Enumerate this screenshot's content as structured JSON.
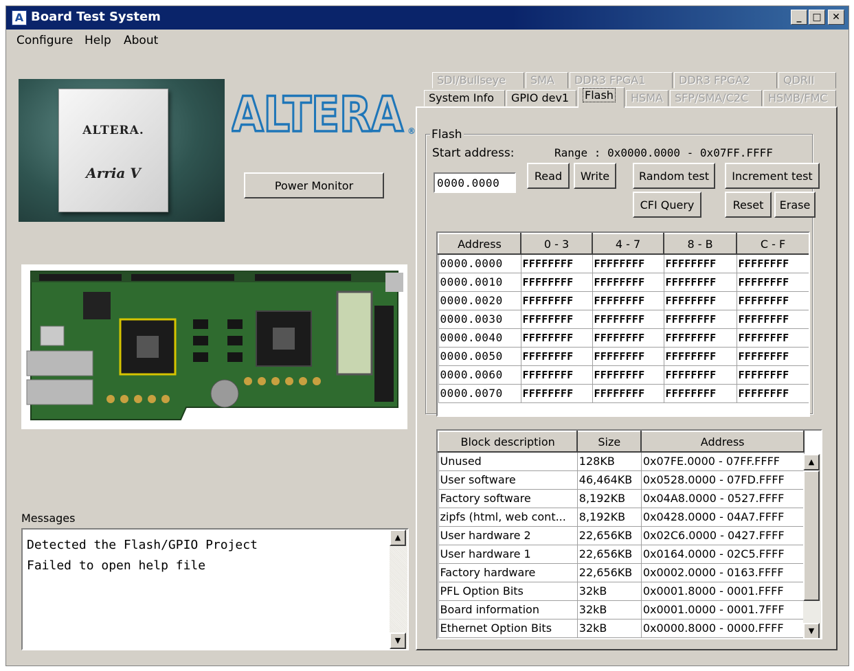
{
  "window": {
    "title": "Board Test System",
    "app_icon": "A"
  },
  "titlebar_buttons": {
    "minimize": "_",
    "maximize": "□",
    "close": "✕"
  },
  "menu": [
    "Configure",
    "Help",
    "About"
  ],
  "chip": {
    "brand": "ALTERA.",
    "family": "Arria V"
  },
  "logo": {
    "text": "ALTERA",
    "mark": "®"
  },
  "power_monitor_label": "Power Monitor",
  "messages": {
    "label": "Messages",
    "lines": "Detected the Flash/GPIO Project\nFailed to open help file"
  },
  "tabs": {
    "row_back": [
      "SDI/Bullseye",
      "SMA",
      "DDR3 FPGA1",
      "DDR3 FPGA2",
      "QDRII"
    ],
    "row_front": [
      "System Info",
      "GPIO dev1",
      "Flash",
      "HSMA",
      "SFP/SMA/C2C",
      "HSMB/FMC"
    ],
    "active": "Flash"
  },
  "flash": {
    "group_title": "Flash",
    "start_address_label": "Start address:",
    "start_address_value": "0000.0000",
    "range_label": "Range : 0x0000.0000 - 0x07FF.FFFF",
    "buttons": {
      "read": "Read",
      "write": "Write",
      "random_test": "Random test",
      "increment_test": "Increment test",
      "cfi_query": "CFI Query",
      "reset": "Reset",
      "erase": "Erase"
    }
  },
  "memory_table": {
    "headers": [
      "Address",
      "0 - 3",
      "4 - 7",
      "8 - B",
      "C - F"
    ],
    "rows": [
      [
        "0000.0000",
        "FFFFFFFF",
        "FFFFFFFF",
        "FFFFFFFF",
        "FFFFFFFF"
      ],
      [
        "0000.0010",
        "FFFFFFFF",
        "FFFFFFFF",
        "FFFFFFFF",
        "FFFFFFFF"
      ],
      [
        "0000.0020",
        "FFFFFFFF",
        "FFFFFFFF",
        "FFFFFFFF",
        "FFFFFFFF"
      ],
      [
        "0000.0030",
        "FFFFFFFF",
        "FFFFFFFF",
        "FFFFFFFF",
        "FFFFFFFF"
      ],
      [
        "0000.0040",
        "FFFFFFFF",
        "FFFFFFFF",
        "FFFFFFFF",
        "FFFFFFFF"
      ],
      [
        "0000.0050",
        "FFFFFFFF",
        "FFFFFFFF",
        "FFFFFFFF",
        "FFFFFFFF"
      ],
      [
        "0000.0060",
        "FFFFFFFF",
        "FFFFFFFF",
        "FFFFFFFF",
        "FFFFFFFF"
      ],
      [
        "0000.0070",
        "FFFFFFFF",
        "FFFFFFFF",
        "FFFFFFFF",
        "FFFFFFFF"
      ]
    ]
  },
  "block_table": {
    "headers": [
      "Block description",
      "Size",
      "Address"
    ],
    "rows": [
      [
        "Unused",
        "128KB",
        "0x07FE.0000 - 07FF.FFFF"
      ],
      [
        "User software",
        "46,464KB",
        "0x0528.0000 - 07FD.FFFF"
      ],
      [
        "Factory software",
        "8,192KB",
        "0x04A8.0000 - 0527.FFFF"
      ],
      [
        "zipfs (html, web cont...",
        "8,192KB",
        "0x0428.0000 - 04A7.FFFF"
      ],
      [
        "User hardware 2",
        "22,656KB",
        "0x02C6.0000 - 0427.FFFF"
      ],
      [
        "User hardware 1",
        "22,656KB",
        "0x0164.0000 - 02C5.FFFF"
      ],
      [
        "Factory hardware",
        "22,656KB",
        "0x0002.0000 - 0163.FFFF"
      ],
      [
        "PFL Option Bits",
        "32kB",
        "0x0001.8000 - 0001.FFFF"
      ],
      [
        "Board information",
        "32kB",
        "0x0001.0000 - 0001.7FFF"
      ],
      [
        "Ethernet Option Bits",
        "32kB",
        "0x0000.8000 - 0000.FFFF"
      ]
    ]
  },
  "colors": {
    "titlebar": "#0a246a",
    "face": "#d4d0c8",
    "logo_blue": "#1f76b8"
  }
}
